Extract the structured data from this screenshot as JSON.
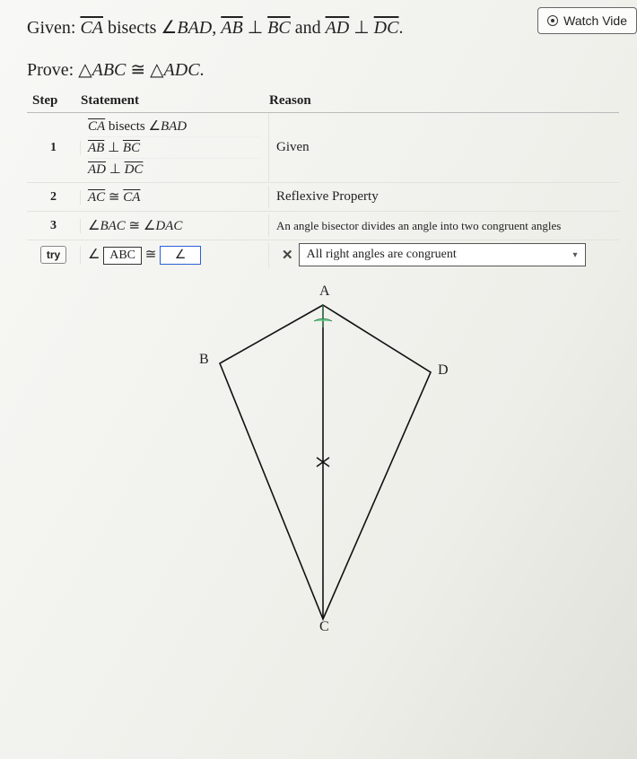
{
  "header": {
    "watch_label": "Watch Vide"
  },
  "problem": {
    "given_label": "Given:",
    "given_math_html": "<span class='ov mi'>CA</span> bisects ∠<span class='mi'>BAD</span>, <span class='ov mi'>AB</span> <span class='perp'>⊥</span> <span class='ov mi'>BC</span> and <span class='ov mi'>AD</span> <span class='perp'>⊥</span> <span class='ov mi'>DC</span>.",
    "prove_label": "Prove:",
    "prove_math_html": "△<span class='mi'>ABC</span> <span class='cong'>≅</span> △<span class='mi'>ADC</span>."
  },
  "table": {
    "h_step": "Step",
    "h_stmt": "Statement",
    "h_reason": "Reason",
    "row1": {
      "step": "1",
      "s1": "<span class='ov mi'>CA</span> bisects ∠<span class='mi'>BAD</span>",
      "s2": "<span class='ov mi'>AB</span> <span class='perp'>⊥</span> <span class='ov mi'>BC</span>",
      "s3": "<span class='ov mi'>AD</span> <span class='perp'>⊥</span> <span class='ov mi'>DC</span>",
      "reason": "Given"
    },
    "row2": {
      "step": "2",
      "stmt": "<span class='ov mi'>AC</span> <span class='cong'>≅</span> <span class='ov mi'>CA</span>",
      "reason": "Reflexive Property"
    },
    "row3": {
      "step": "3",
      "stmt": "∠<span class='mi'>BAC</span> <span class='cong'>≅</span> ∠<span class='mi'>DAC</span>",
      "reason": "An angle bisector divides an angle into two congruent angles"
    },
    "row4": {
      "try": "try",
      "angle_sym": "∠",
      "box1": "ABC",
      "cong": "≅",
      "box2_prefix": "∠",
      "box2_val": "",
      "x": "✕",
      "reason_selected": "All right angles are congruent"
    }
  },
  "figure": {
    "A": "A",
    "B": "B",
    "C": "C",
    "D": "D"
  }
}
